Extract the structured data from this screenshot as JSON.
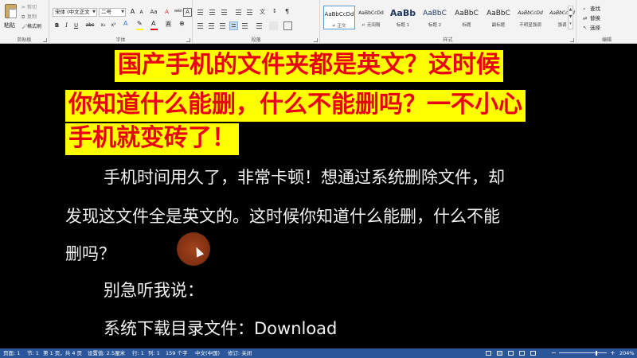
{
  "ribbon": {
    "clipboard": {
      "paste_label": "粘贴",
      "cut_label": "剪切",
      "copy_label": "复制",
      "format_painter_label": "格式刷",
      "group_label": "剪贴板"
    },
    "font": {
      "font_name": "宋体 (中文正文",
      "font_size": "二号",
      "group_label": "字体",
      "bold": "B",
      "italic": "I",
      "underline": "U",
      "strike": "abc",
      "subscript": "x₂",
      "superscript": "x²",
      "grow": "A",
      "shrink": "A",
      "case": "Aa",
      "clear": "A",
      "phonetic": "wén",
      "border": "A",
      "highlight_color": "#ffff00",
      "font_color": "#e60012"
    },
    "paragraph": {
      "group_label": "段落"
    },
    "styles": {
      "group_label": "样式",
      "items": [
        {
          "sample": "AaBbCcDd",
          "name": "↵ 正文"
        },
        {
          "sample": "AaBbCcDd",
          "name": "↵ 无间隔"
        },
        {
          "sample": "AaBb",
          "name": "标题 1"
        },
        {
          "sample": "AaBbC",
          "name": "标题 2"
        },
        {
          "sample": "AaBbC",
          "name": "标题"
        },
        {
          "sample": "AaBbC",
          "name": "副标题"
        },
        {
          "sample": "AaBbCcDd",
          "name": "不明显强调"
        },
        {
          "sample": "AaBbCcDd",
          "name": "强调"
        }
      ]
    },
    "editing": {
      "find_label": "查找",
      "replace_label": "替换",
      "select_label": "选择",
      "group_label": "编辑"
    }
  },
  "document": {
    "title_lines": [
      "国产手机的文件夹都是英文？这时候",
      "你知道什么能删，什么不能删吗？一不小心",
      "手机就变砖了！"
    ],
    "body_lines": [
      "手机时间用久了，非常卡顿！想通过系统删除文件，却",
      "发现这文件全是英文的。这时候你知道什么能删，什么不能",
      "删吗？",
      "别急听我说：",
      "系统下载目录文件：Download"
    ],
    "title_color": "#e60012",
    "highlight_color": "#ffff00"
  },
  "status_bar": {
    "page": "页面: 1",
    "section": "节: 1",
    "page_of": "第 1 页，共 4 页",
    "position": "设置值: 2.5厘米",
    "line": "行: 1",
    "column": "列: 1",
    "word_count": "159 个字",
    "language": "中文(中国)",
    "track_changes": "修订: 关闭",
    "zoom_level": "204%",
    "zoom_fraction": 0.77
  }
}
